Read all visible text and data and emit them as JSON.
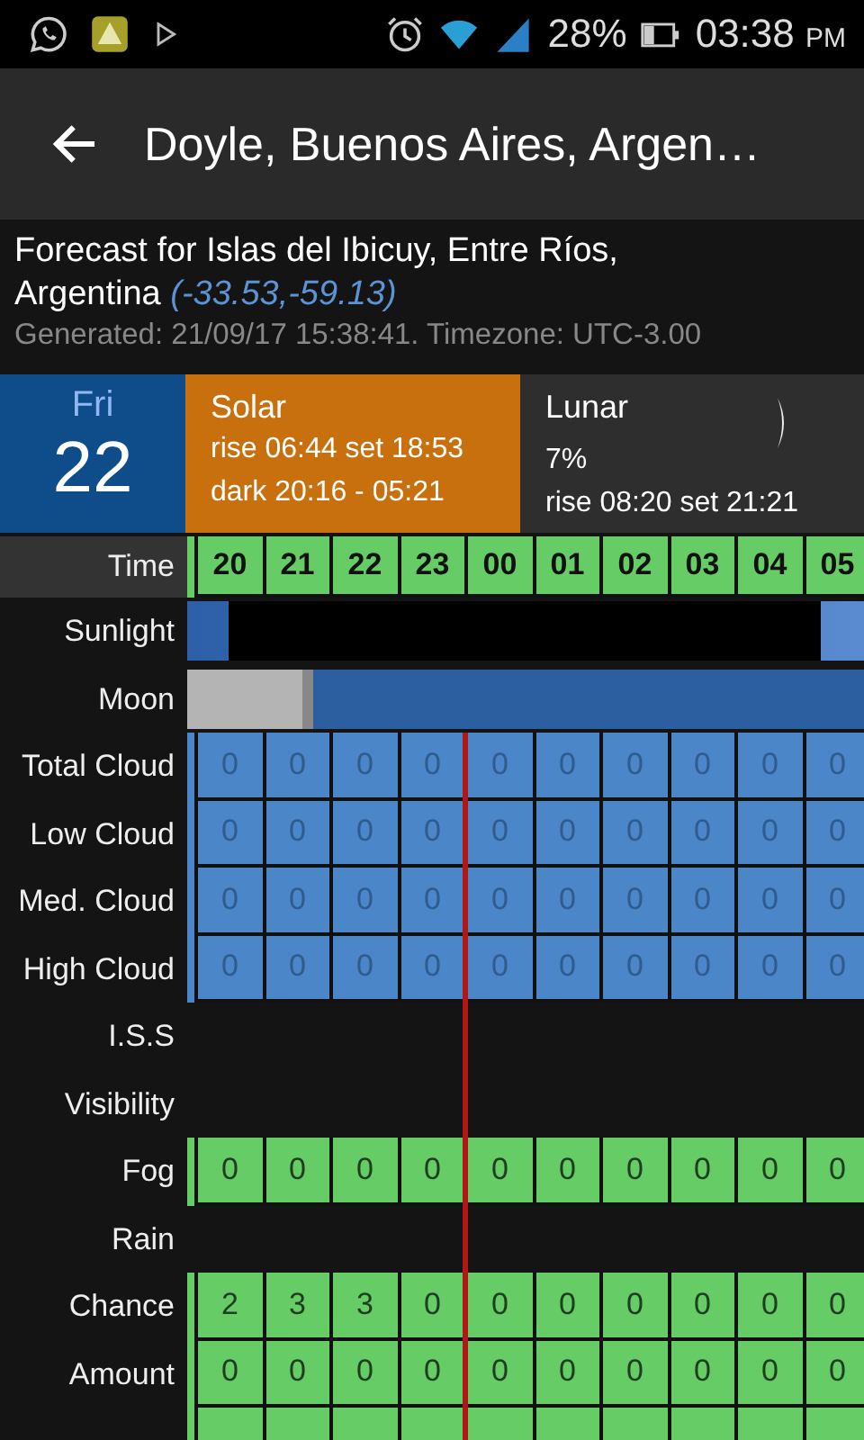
{
  "status_bar": {
    "battery": "28%",
    "time": "03:38",
    "ampm": "PM"
  },
  "toolbar": {
    "title": "Doyle, Buenos Aires, Argen…"
  },
  "header": {
    "location": "Forecast for Islas del Ibicuy, Entre Ríos, Argentina",
    "coords": "(-33.53,-59.13)",
    "generated": "Generated: 21/09/17 15:38:41. Timezone: UTC-3.00"
  },
  "day": {
    "weekday": "Fri",
    "date": "22"
  },
  "solar": {
    "title": "Solar",
    "lines": [
      "rise 06:44 set 18:53",
      "dark 20:16 - 05:21"
    ]
  },
  "lunar": {
    "title": "Lunar",
    "illumination": "7%",
    "times": "rise 08:20 set 21:21"
  },
  "time_row": {
    "label": "Time",
    "hours": [
      {
        "label": "20",
        "now": false
      },
      {
        "label": "21",
        "now": false
      },
      {
        "label": "22",
        "now": false
      },
      {
        "label": "23",
        "now": false
      },
      {
        "label": "00",
        "now": true
      },
      {
        "label": "01",
        "now": false
      },
      {
        "label": "02",
        "now": false
      },
      {
        "label": "03",
        "now": false
      },
      {
        "label": "04",
        "now": false
      },
      {
        "label": "05",
        "now": false
      }
    ]
  },
  "rows": [
    {
      "label": "Sunlight",
      "kind": "sunlight"
    },
    {
      "label": "Moon",
      "kind": "moon",
      "level": 0.17
    },
    {
      "label": "Total Cloud",
      "kind": "cells",
      "color": "#4a86c8",
      "values": [
        "0",
        "0",
        "0",
        "0",
        "0",
        "0",
        "0",
        "0",
        "0",
        "0"
      ]
    },
    {
      "label": "Low Cloud",
      "kind": "cells",
      "color": "#4a86c8",
      "values": [
        "0",
        "0",
        "0",
        "0",
        "0",
        "0",
        "0",
        "0",
        "0",
        "0"
      ]
    },
    {
      "label": "Med. Cloud",
      "kind": "cells",
      "color": "#4a86c8",
      "values": [
        "0",
        "0",
        "0",
        "0",
        "0",
        "0",
        "0",
        "0",
        "0",
        "0"
      ]
    },
    {
      "label": "High Cloud",
      "kind": "cells",
      "color": "#4a86c8",
      "values": [
        "0",
        "0",
        "0",
        "0",
        "0",
        "0",
        "0",
        "0",
        "0",
        "0"
      ]
    },
    {
      "label": "I.S.S",
      "kind": "empty"
    },
    {
      "label": "Visibility",
      "kind": "empty"
    },
    {
      "label": "Fog",
      "kind": "cells",
      "color": "#66cc66",
      "values": [
        "0",
        "0",
        "0",
        "0",
        "0",
        "0",
        "0",
        "0",
        "0",
        "0"
      ]
    },
    {
      "label": "Rain",
      "kind": "empty"
    },
    {
      "label": "Chance",
      "kind": "cells",
      "color": "#66cc66",
      "values": [
        "2",
        "3",
        "3",
        "0",
        "0",
        "0",
        "0",
        "0",
        "0",
        "0"
      ]
    },
    {
      "label": "Amount",
      "kind": "cells",
      "color": "#66cc66",
      "values": [
        "0",
        "0",
        "0",
        "0",
        "0",
        "0",
        "0",
        "0",
        "0",
        "0"
      ]
    },
    {
      "kind": "blank_cells",
      "color": "#66cc66"
    }
  ]
}
